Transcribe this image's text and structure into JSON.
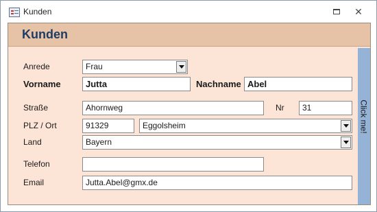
{
  "window": {
    "title": "Kunden"
  },
  "form": {
    "header_title": "Kunden",
    "side_button": "Click me!",
    "labels": {
      "anrede": "Anrede",
      "vorname": "Vorname",
      "nachname": "Nachname",
      "strasse": "Straße",
      "nr": "Nr",
      "plz_ort": "PLZ / Ort",
      "land": "Land",
      "telefon": "Telefon",
      "email": "Email"
    },
    "values": {
      "anrede": "Frau",
      "vorname": "Jutta",
      "nachname": "Abel",
      "strasse": "Ahornweg",
      "nr": "31",
      "plz": "91329",
      "ort": "Eggolsheim",
      "land": "Bayern",
      "telefon": "",
      "email": "Jutta.Abel@gmx.de"
    }
  },
  "icons": [
    "form-icon",
    "restore-icon",
    "close-icon",
    "dropdown-arrow-icon"
  ]
}
